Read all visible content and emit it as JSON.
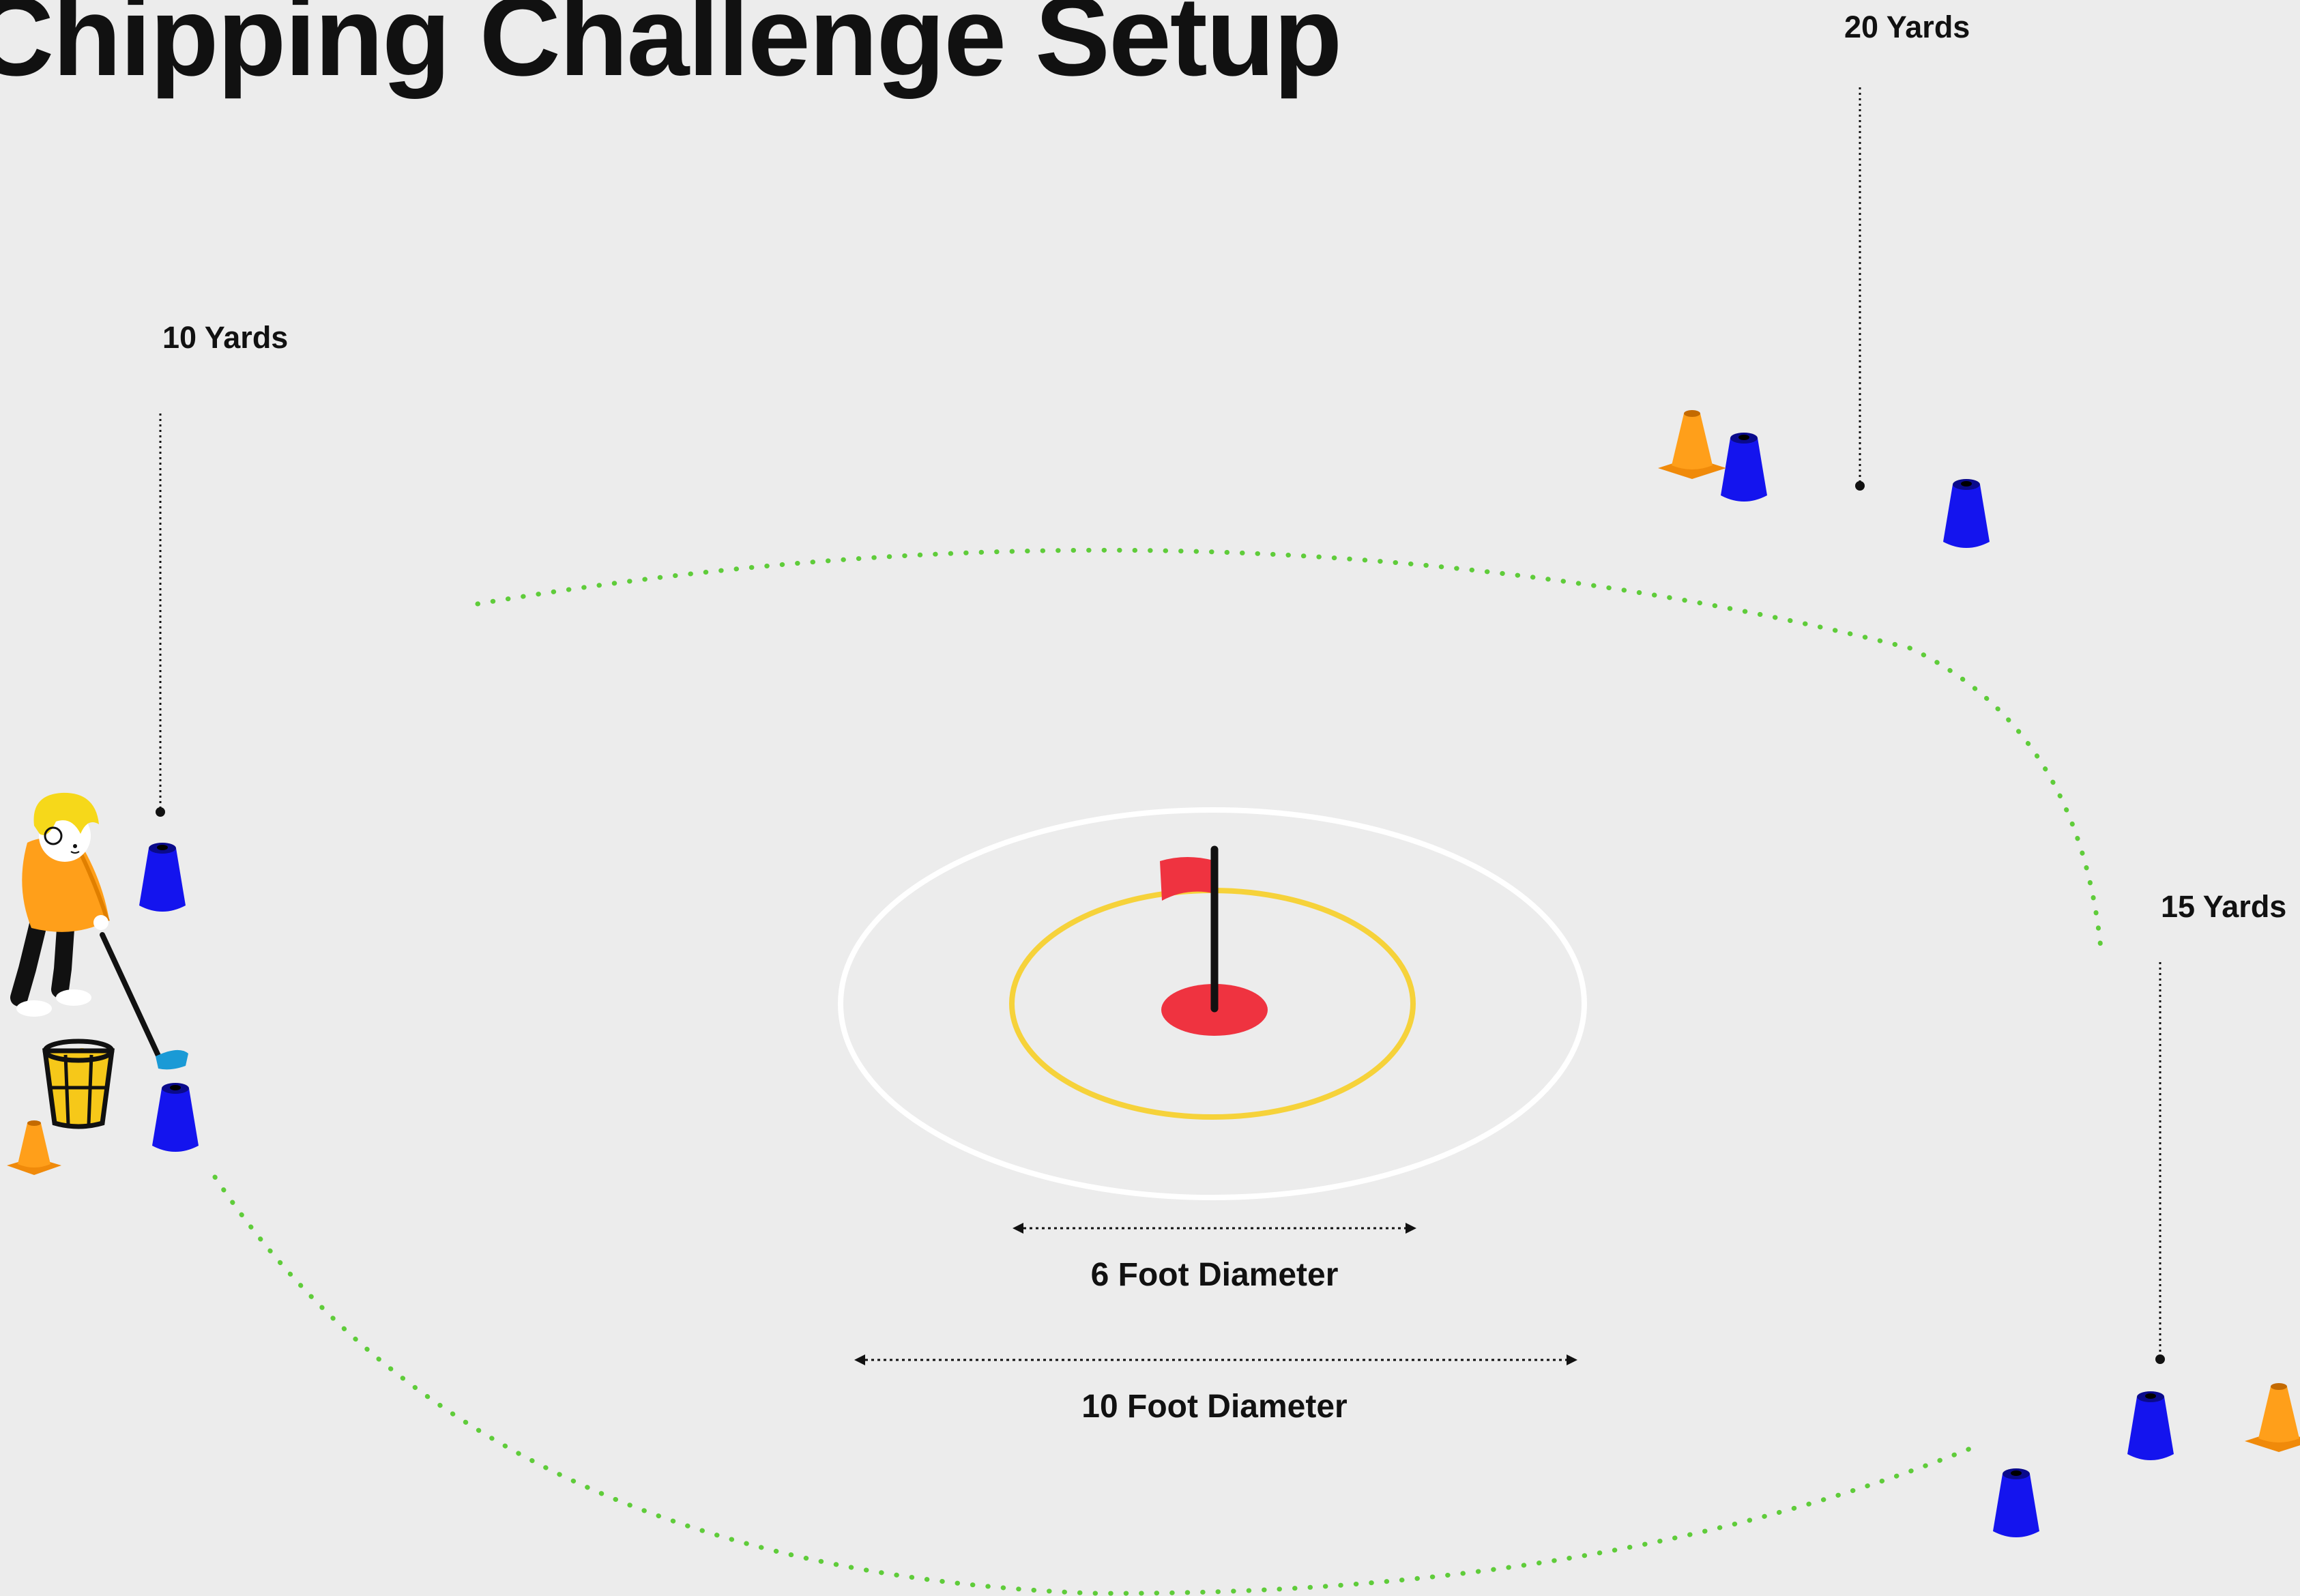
{
  "title": "Chipping Challenge Setup",
  "distance_labels": {
    "ten": "10 Yards",
    "fifteen": "15 Yards",
    "twenty": "20 Yards"
  },
  "diameter_labels": {
    "inner": "6 Foot Diameter",
    "outer": "10 Foot Diameter"
  },
  "colors": {
    "background": "#ececec",
    "cone_blue": "#1414ee",
    "cone_orange": "#ff9f1a",
    "boundary_dots": "#5fcc3a",
    "inner_ring": "#f6d23a",
    "outer_ring": "#ffffff",
    "flag": "#ef3340",
    "ball_yellow": "#f6c819",
    "golfer_shirt": "#ff9f1a"
  },
  "icons": [
    "golfer-icon",
    "ball-bucket-icon",
    "flag-icon",
    "cone-icon"
  ]
}
